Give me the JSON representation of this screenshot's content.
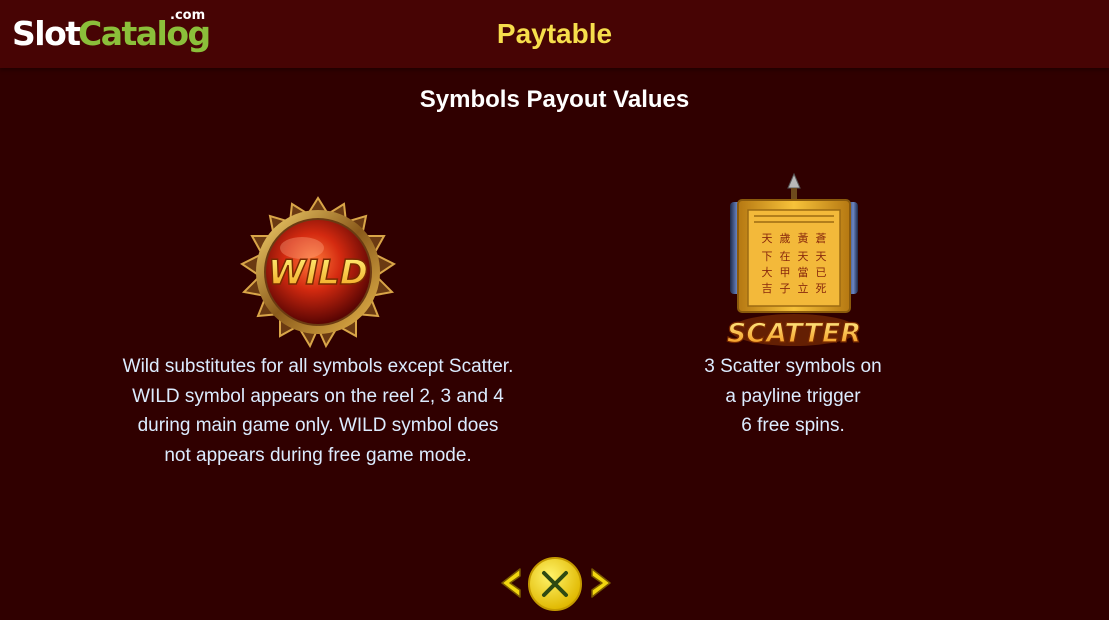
{
  "header": {
    "logo": {
      "part1": "Slot",
      "part2": "Catalog",
      "suffix": ".com"
    },
    "title": "Paytable"
  },
  "section_title": "Symbols Payout Values",
  "symbols": [
    {
      "name": "WILD",
      "image_text": "WILD",
      "description_lines": [
        "Wild substitutes for all symbols except Scatter.",
        "WILD symbol appears on the reel 2, 3 and 4",
        "during main game only. WILD symbol does",
        "not appears during free game mode."
      ]
    },
    {
      "name": "SCATTER",
      "image_text": "SCATTER",
      "scroll_glyphs": [
        "天",
        "歲",
        "黃",
        "蒼",
        "下",
        "在",
        "天",
        "天",
        "大",
        "甲",
        "當",
        "已",
        "吉",
        "子",
        "立",
        "死"
      ],
      "description_lines": [
        "3 Scatter symbols on",
        "a payline trigger",
        "6 free spins."
      ]
    }
  ],
  "navigation": {
    "prev_icon": "chevron-left-icon",
    "close_icon": "close-x-icon",
    "next_icon": "chevron-right-icon"
  },
  "colors": {
    "background": "#300000",
    "header_bg": "#470404",
    "title": "#f6de4c",
    "logo_green": "#8bbf3a",
    "text": "#dcecff",
    "button": "#f1d60f"
  }
}
